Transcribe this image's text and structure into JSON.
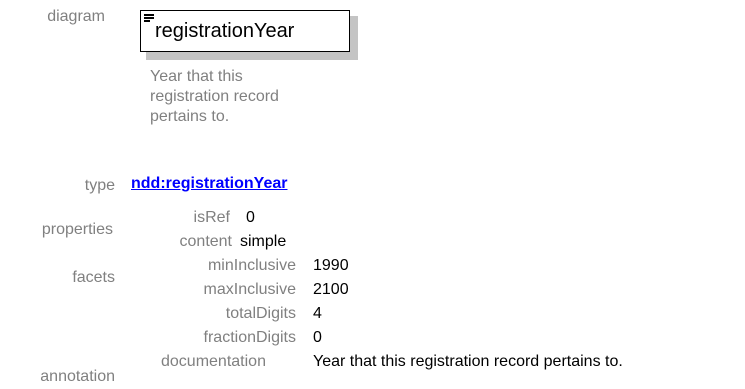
{
  "labels": {
    "diagram": "diagram",
    "type": "type",
    "properties": "properties",
    "facets": "facets",
    "annotation": "annotation"
  },
  "diagram": {
    "element_name": "registrationYear",
    "element_doc": "Year that this registration record pertains to.",
    "icon": "element-icon"
  },
  "type": {
    "link_text": "ndd:registrationYear",
    "link_color": "#0000ff"
  },
  "properties": [
    {
      "key": "isRef",
      "value": "0"
    },
    {
      "key": "content",
      "value": "simple"
    }
  ],
  "facets": [
    {
      "key": "minInclusive",
      "value": "1990"
    },
    {
      "key": "maxInclusive",
      "value": "2100"
    },
    {
      "key": "totalDigits",
      "value": "4"
    },
    {
      "key": "fractionDigits",
      "value": "0"
    }
  ],
  "annotation": {
    "key": "documentation",
    "value": "Year that this registration record pertains to."
  },
  "colors": {
    "label_gray": "#808080",
    "shadow": "#c4c4c4"
  }
}
